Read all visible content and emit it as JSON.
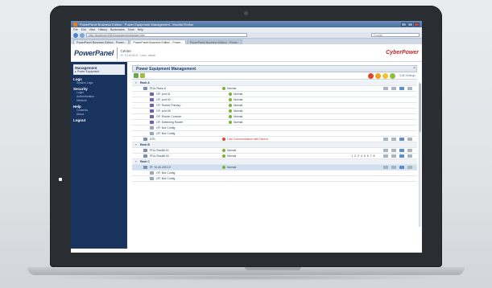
{
  "browser": {
    "title": "PowerPanel Business Edition - Power Equipment Management - Mozilla Firefox",
    "menu": [
      "File",
      "Edit",
      "View",
      "History",
      "Bookmarks",
      "Tools",
      "Help"
    ],
    "address": "http://localhost:3052/management/power.htm",
    "search_placeholder": "Google",
    "tabs": [
      "PowerPanel Business Edition - Power...",
      "PowerPanel Business Edition - Power...",
      "PowerPanel Business Edition - Power..."
    ]
  },
  "header": {
    "logo": "PowerPanel",
    "host_name": "Center",
    "host_sub": "IP: 10.40.80.5 · User: admin",
    "brand": "CyberPower"
  },
  "sidebar": {
    "top_title": "Management",
    "top_sub": "▸ Power Equipment",
    "sections": [
      {
        "title": "Logs",
        "items": [
          "System Logs"
        ]
      },
      {
        "title": "Security",
        "items": [
          "Login",
          "Authentication",
          "Network"
        ]
      },
      {
        "title": "Help",
        "items": [
          "Contents",
          "About"
        ]
      },
      {
        "title": "Logout",
        "items": []
      }
    ]
  },
  "main": {
    "page_title": "Power Equipment Management",
    "close": "×",
    "edit_link": "Edit Settings"
  },
  "groups": [
    {
      "label": "Rack A",
      "rows": [
        {
          "name": "PDU-Rack-A",
          "level": 1,
          "status": "Normal",
          "status_type": "ok",
          "icon": "pdu",
          "actions": true,
          "selected": false
        },
        {
          "name": "OF: port 01",
          "level": 2,
          "status": "Normal",
          "status_type": "ok",
          "icon": "outlet",
          "actions": false,
          "selected": false
        },
        {
          "name": "OF: port 02",
          "level": 2,
          "status": "Normal",
          "status_type": "ok",
          "icon": "outlet",
          "actions": false,
          "selected": false
        },
        {
          "name": "OF: Router Primary",
          "level": 2,
          "status": "Normal",
          "status_type": "ok",
          "icon": "outlet",
          "actions": false,
          "selected": false
        },
        {
          "name": "OF: port 05",
          "level": 2,
          "status": "Normal",
          "status_type": "ok",
          "icon": "outlet",
          "actions": false,
          "selected": false
        },
        {
          "name": "OF: Router Console",
          "level": 2,
          "status": "Normal",
          "status_type": "ok",
          "icon": "outlet",
          "actions": false,
          "selected": false
        },
        {
          "name": "OF: Switching Router",
          "level": 2,
          "status": "Normal",
          "status_type": "ok",
          "icon": "outlet",
          "actions": false,
          "selected": false
        },
        {
          "name": "OF: Not Config",
          "level": 2,
          "status": "",
          "status_type": "none",
          "icon": "outlet-gray",
          "actions": false,
          "selected": false
        },
        {
          "name": "OF: Not Config",
          "level": 2,
          "status": "",
          "status_type": "none",
          "icon": "outlet-gray",
          "actions": false,
          "selected": false
        },
        {
          "name": "ATS",
          "level": 1,
          "status": "Lost Communication with Device",
          "status_type": "warn",
          "icon": "ats",
          "actions": true,
          "selected": false
        }
      ]
    },
    {
      "label": "Rack B",
      "rows": [
        {
          "name": "PDU-RackB-01",
          "level": 1,
          "status": "Normal",
          "status_type": "ok",
          "icon": "pdu",
          "actions": true,
          "selected": false
        },
        {
          "name": "PDU-RackB-02",
          "level": 1,
          "status": "Normal",
          "status_type": "ok",
          "icon": "pdu",
          "actions": true,
          "selected": false,
          "outlet_numbers": "1 2 3 4 5 6 7 8"
        }
      ]
    },
    {
      "label": "Rack C",
      "rows": [
        {
          "name": "IP: 10.40.200.10",
          "level": 1,
          "status": "Normal",
          "status_type": "ok",
          "icon": "pdu",
          "actions": true,
          "selected": true
        },
        {
          "name": "OF: Not Config",
          "level": 2,
          "status": "",
          "status_type": "none",
          "icon": "outlet-gray",
          "actions": false,
          "selected": false
        },
        {
          "name": "OF: Not Config",
          "level": 2,
          "status": "",
          "status_type": "none",
          "icon": "outlet-gray",
          "actions": false,
          "selected": false
        }
      ]
    }
  ],
  "colors": {
    "sidebar": "#18345e",
    "accent": "#1f3b66",
    "ok": "#79b431",
    "warn": "#e0442b",
    "brand": "#c7242c"
  }
}
